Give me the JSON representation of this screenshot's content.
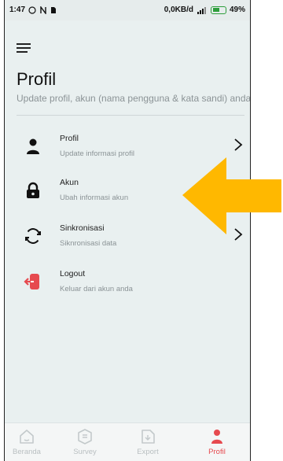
{
  "status_bar": {
    "time": "1:47",
    "network_speed": "0,0KB/d",
    "battery_percent": "49%",
    "icons": [
      "whatsapp-icon",
      "n-icon",
      "sim-icon",
      "signal-icon",
      "battery-charging-icon"
    ]
  },
  "header": {
    "title": "Profil",
    "subtitle": "Update profil, akun (nama pengguna & kata sandi) anda"
  },
  "menu": [
    {
      "icon": "person-icon",
      "title": "Profil",
      "subtitle": "Update informasi profil",
      "has_chevron": true
    },
    {
      "icon": "lock-icon",
      "title": "Akun",
      "subtitle": "Ubah informasi akun",
      "has_chevron": false
    },
    {
      "icon": "sync-icon",
      "title": "Sinkronisasi",
      "subtitle": "Siknronisasi data",
      "has_chevron": true
    },
    {
      "icon": "logout-icon",
      "title": "Logout",
      "subtitle": "Keluar dari akun anda",
      "has_chevron": false
    }
  ],
  "bottom_nav": [
    {
      "icon": "home-icon",
      "label": "Beranda",
      "active": false
    },
    {
      "icon": "survey-icon",
      "label": "Survey",
      "active": false
    },
    {
      "icon": "export-icon",
      "label": "Export",
      "active": false
    },
    {
      "icon": "profile-icon",
      "label": "Profil",
      "active": true
    }
  ],
  "colors": {
    "accent": "#e64a4f",
    "arrow": "#ffb800",
    "background": "#e9f0f0"
  }
}
